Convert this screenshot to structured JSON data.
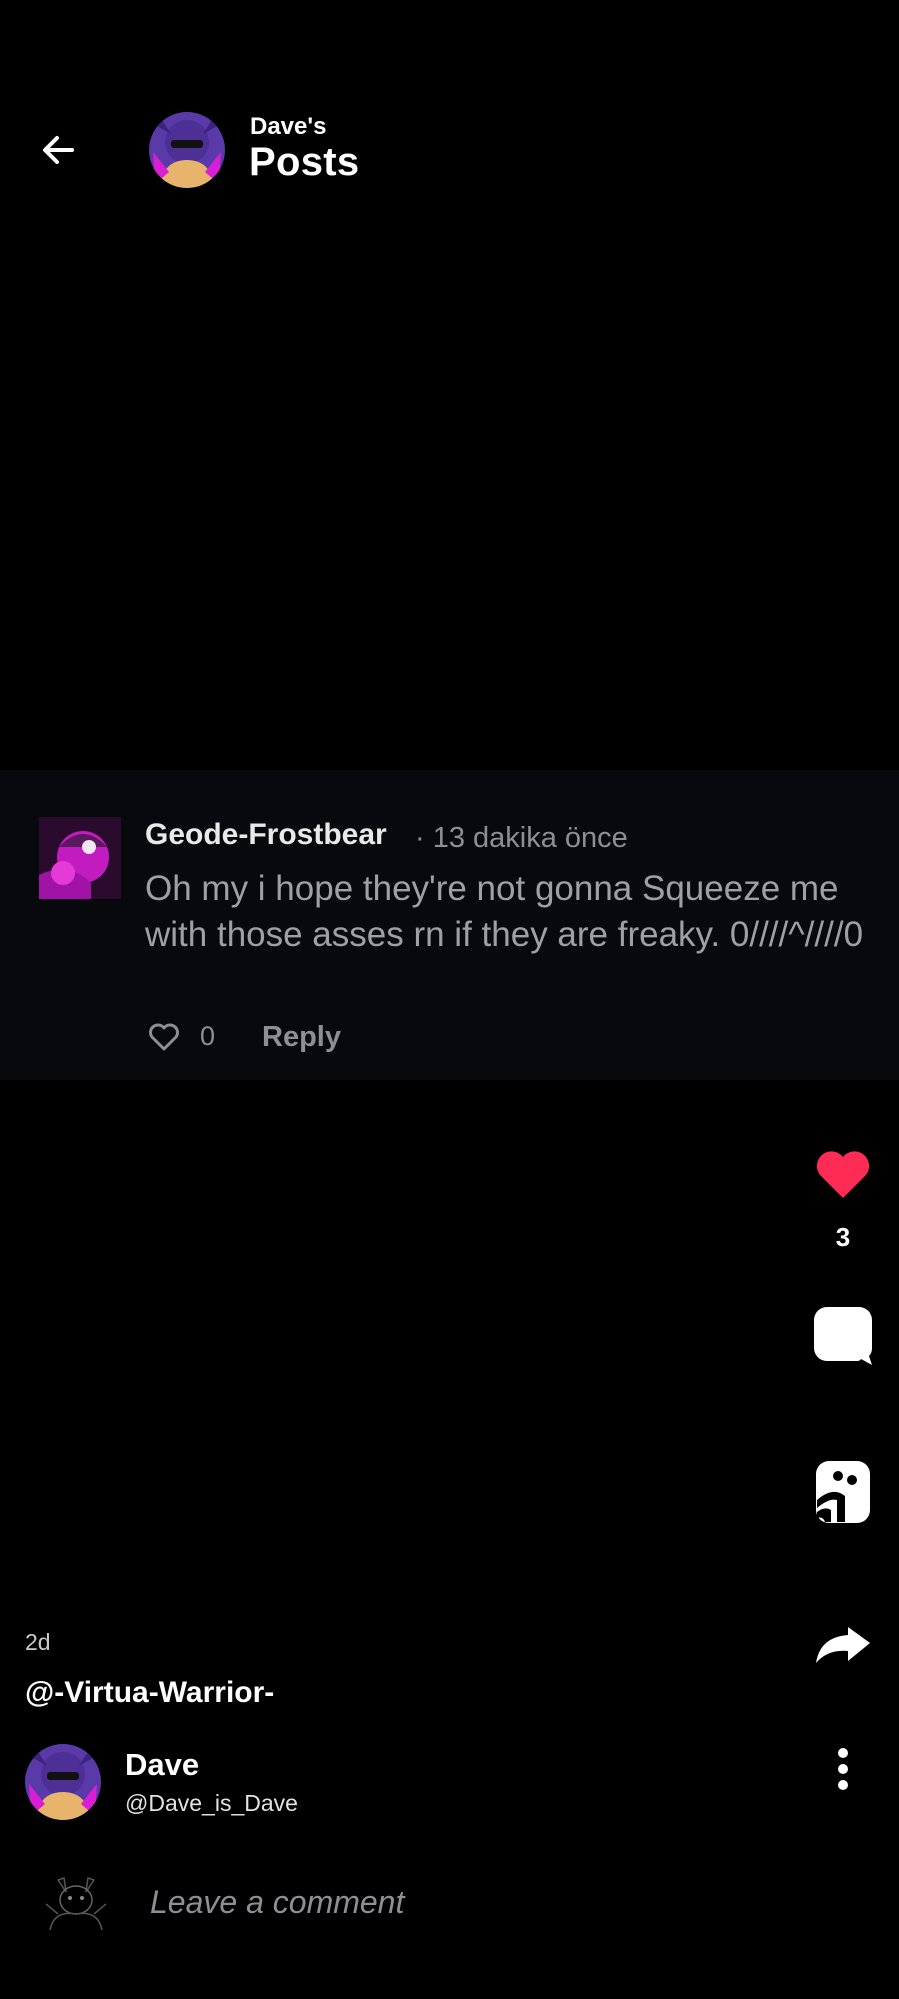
{
  "header": {
    "owner": "Dave's",
    "title": "Posts"
  },
  "comment": {
    "author": "Geode-Frostbear",
    "time": "· 13 dakika önce",
    "text": "Oh my i hope they're not gonna Squeeze me with those asses rn if they are freaky. 0////^////0",
    "like_count": "0",
    "reply_label": "Reply"
  },
  "actions": {
    "like_count": "3"
  },
  "post": {
    "age": "2d",
    "mention": "@-Virtua-Warrior-",
    "author_name": "Dave",
    "author_handle": "@Dave_is_Dave"
  },
  "composer": {
    "placeholder": "Leave a comment"
  },
  "colors": {
    "like_accent": "#fe2c55",
    "avatar_purple": "#6b3fb5",
    "avatar_pink": "#d81fd6"
  },
  "icons": [
    "back-arrow-icon",
    "heart-outline-icon",
    "heart-filled-icon",
    "chat-bubble-icon",
    "remix-icon",
    "share-arrow-icon",
    "more-vertical-icon"
  ]
}
